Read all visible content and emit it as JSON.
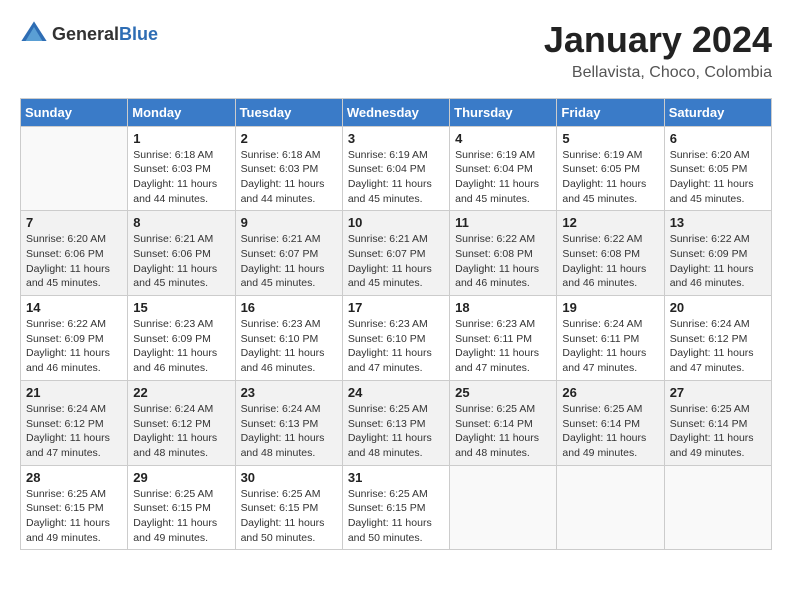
{
  "header": {
    "logo_general": "General",
    "logo_blue": "Blue",
    "title": "January 2024",
    "subtitle": "Bellavista, Choco, Colombia"
  },
  "calendar": {
    "days_of_week": [
      "Sunday",
      "Monday",
      "Tuesday",
      "Wednesday",
      "Thursday",
      "Friday",
      "Saturday"
    ],
    "weeks": [
      [
        {
          "day": "",
          "info": ""
        },
        {
          "day": "1",
          "info": "Sunrise: 6:18 AM\nSunset: 6:03 PM\nDaylight: 11 hours\nand 44 minutes."
        },
        {
          "day": "2",
          "info": "Sunrise: 6:18 AM\nSunset: 6:03 PM\nDaylight: 11 hours\nand 44 minutes."
        },
        {
          "day": "3",
          "info": "Sunrise: 6:19 AM\nSunset: 6:04 PM\nDaylight: 11 hours\nand 45 minutes."
        },
        {
          "day": "4",
          "info": "Sunrise: 6:19 AM\nSunset: 6:04 PM\nDaylight: 11 hours\nand 45 minutes."
        },
        {
          "day": "5",
          "info": "Sunrise: 6:19 AM\nSunset: 6:05 PM\nDaylight: 11 hours\nand 45 minutes."
        },
        {
          "day": "6",
          "info": "Sunrise: 6:20 AM\nSunset: 6:05 PM\nDaylight: 11 hours\nand 45 minutes."
        }
      ],
      [
        {
          "day": "7",
          "info": "Sunrise: 6:20 AM\nSunset: 6:06 PM\nDaylight: 11 hours\nand 45 minutes."
        },
        {
          "day": "8",
          "info": "Sunrise: 6:21 AM\nSunset: 6:06 PM\nDaylight: 11 hours\nand 45 minutes."
        },
        {
          "day": "9",
          "info": "Sunrise: 6:21 AM\nSunset: 6:07 PM\nDaylight: 11 hours\nand 45 minutes."
        },
        {
          "day": "10",
          "info": "Sunrise: 6:21 AM\nSunset: 6:07 PM\nDaylight: 11 hours\nand 45 minutes."
        },
        {
          "day": "11",
          "info": "Sunrise: 6:22 AM\nSunset: 6:08 PM\nDaylight: 11 hours\nand 46 minutes."
        },
        {
          "day": "12",
          "info": "Sunrise: 6:22 AM\nSunset: 6:08 PM\nDaylight: 11 hours\nand 46 minutes."
        },
        {
          "day": "13",
          "info": "Sunrise: 6:22 AM\nSunset: 6:09 PM\nDaylight: 11 hours\nand 46 minutes."
        }
      ],
      [
        {
          "day": "14",
          "info": "Sunrise: 6:22 AM\nSunset: 6:09 PM\nDaylight: 11 hours\nand 46 minutes."
        },
        {
          "day": "15",
          "info": "Sunrise: 6:23 AM\nSunset: 6:09 PM\nDaylight: 11 hours\nand 46 minutes."
        },
        {
          "day": "16",
          "info": "Sunrise: 6:23 AM\nSunset: 6:10 PM\nDaylight: 11 hours\nand 46 minutes."
        },
        {
          "day": "17",
          "info": "Sunrise: 6:23 AM\nSunset: 6:10 PM\nDaylight: 11 hours\nand 47 minutes."
        },
        {
          "day": "18",
          "info": "Sunrise: 6:23 AM\nSunset: 6:11 PM\nDaylight: 11 hours\nand 47 minutes."
        },
        {
          "day": "19",
          "info": "Sunrise: 6:24 AM\nSunset: 6:11 PM\nDaylight: 11 hours\nand 47 minutes."
        },
        {
          "day": "20",
          "info": "Sunrise: 6:24 AM\nSunset: 6:12 PM\nDaylight: 11 hours\nand 47 minutes."
        }
      ],
      [
        {
          "day": "21",
          "info": "Sunrise: 6:24 AM\nSunset: 6:12 PM\nDaylight: 11 hours\nand 47 minutes."
        },
        {
          "day": "22",
          "info": "Sunrise: 6:24 AM\nSunset: 6:12 PM\nDaylight: 11 hours\nand 48 minutes."
        },
        {
          "day": "23",
          "info": "Sunrise: 6:24 AM\nSunset: 6:13 PM\nDaylight: 11 hours\nand 48 minutes."
        },
        {
          "day": "24",
          "info": "Sunrise: 6:25 AM\nSunset: 6:13 PM\nDaylight: 11 hours\nand 48 minutes."
        },
        {
          "day": "25",
          "info": "Sunrise: 6:25 AM\nSunset: 6:14 PM\nDaylight: 11 hours\nand 48 minutes."
        },
        {
          "day": "26",
          "info": "Sunrise: 6:25 AM\nSunset: 6:14 PM\nDaylight: 11 hours\nand 49 minutes."
        },
        {
          "day": "27",
          "info": "Sunrise: 6:25 AM\nSunset: 6:14 PM\nDaylight: 11 hours\nand 49 minutes."
        }
      ],
      [
        {
          "day": "28",
          "info": "Sunrise: 6:25 AM\nSunset: 6:15 PM\nDaylight: 11 hours\nand 49 minutes."
        },
        {
          "day": "29",
          "info": "Sunrise: 6:25 AM\nSunset: 6:15 PM\nDaylight: 11 hours\nand 49 minutes."
        },
        {
          "day": "30",
          "info": "Sunrise: 6:25 AM\nSunset: 6:15 PM\nDaylight: 11 hours\nand 50 minutes."
        },
        {
          "day": "31",
          "info": "Sunrise: 6:25 AM\nSunset: 6:15 PM\nDaylight: 11 hours\nand 50 minutes."
        },
        {
          "day": "",
          "info": ""
        },
        {
          "day": "",
          "info": ""
        },
        {
          "day": "",
          "info": ""
        }
      ]
    ]
  }
}
